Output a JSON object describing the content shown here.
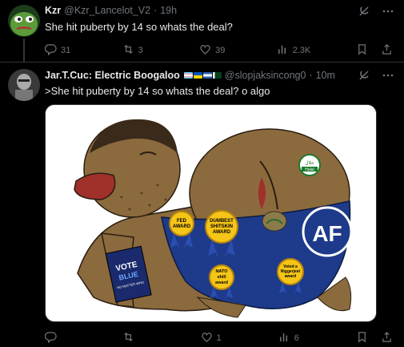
{
  "tweet1": {
    "display_name": "Kzr",
    "handle": "@Kzr_Lancelot_V2",
    "separator": "·",
    "time": "19h",
    "text": "She hit puberty by 14 so whats the deal?",
    "stats": {
      "replies": "31",
      "reposts": "3",
      "likes": "39",
      "views": "2.3K"
    }
  },
  "tweet2": {
    "display_name": "Jar.T.Cuc: Electric Boogaloo",
    "handle": "@slopjaksincong0",
    "separator": "·",
    "time": "10m",
    "text": ">She hit puberty by 14 so whats the deal? o algo",
    "stats": {
      "replies": "",
      "reposts": "",
      "likes": "1",
      "views": "6"
    },
    "media": {
      "book_title": "VOTE",
      "book_subtitle": "BLUE",
      "book_small": "NO MATTER WHO",
      "badge_fed": [
        "FED",
        "AWARD"
      ],
      "badge_dumbest": [
        "DUMBEST",
        "SHITSKIN",
        "AWARD"
      ],
      "badge_nato": [
        "NATO",
        "shill",
        "award"
      ],
      "badge_voted": [
        "Voted a",
        "Niggerjeet",
        "award"
      ],
      "halal_text": "حلال",
      "halal_sub": "Halal",
      "logo_text": "AF"
    }
  },
  "colors": {
    "background": "#000000",
    "text": "#e7e9ea",
    "muted": "#71767b",
    "pants": "#1e3a8a",
    "skin": "#8b6a3e"
  },
  "icons": [
    "grok-icon",
    "more-icon",
    "reply-icon",
    "repost-icon",
    "like-icon",
    "views-icon",
    "bookmark-icon",
    "share-icon"
  ]
}
